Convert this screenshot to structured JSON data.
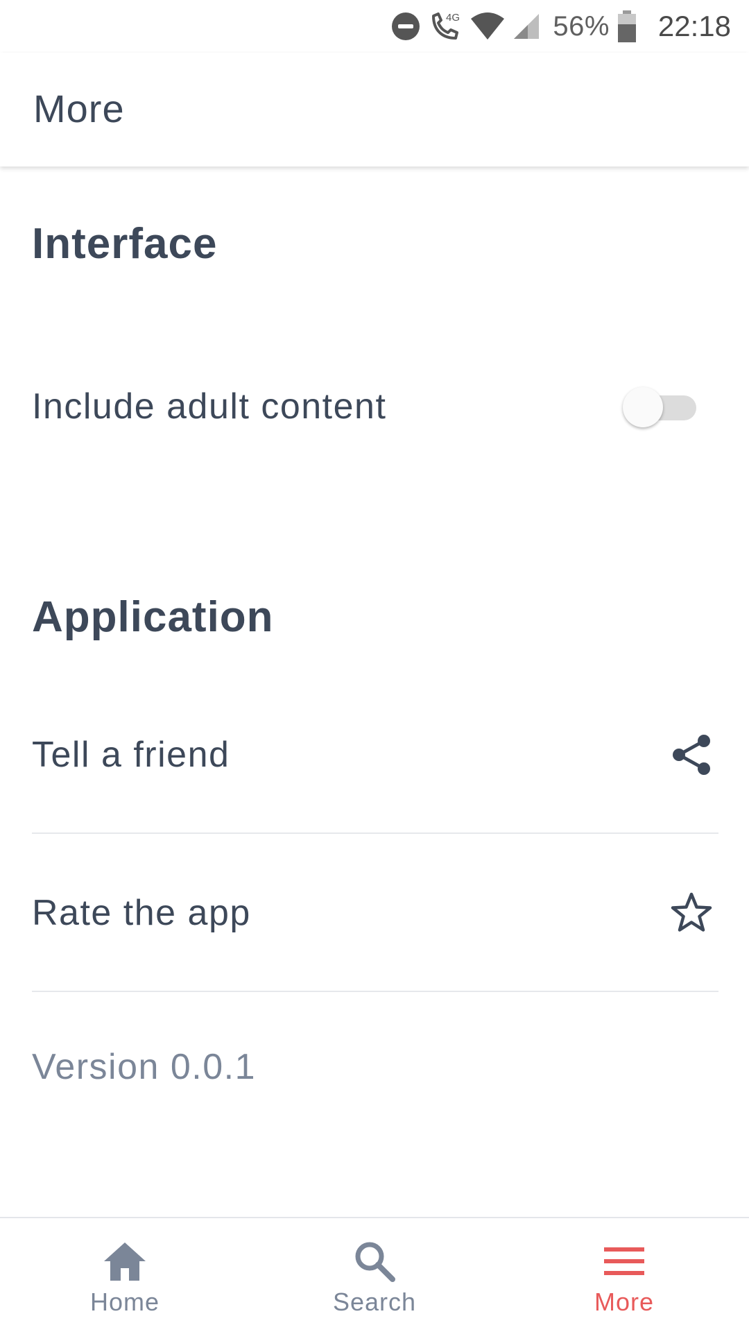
{
  "status_bar": {
    "network_type": "4G",
    "battery_percent": "56%",
    "clock": "22:18",
    "icons": [
      "do-not-disturb-icon",
      "wifi-call-icon",
      "wifi-icon",
      "cell-signal-icon",
      "battery-icon"
    ]
  },
  "toolbar": {
    "title": "More"
  },
  "sections": {
    "interface": {
      "header": "Interface",
      "adult_content_label": "Include adult content",
      "adult_content_enabled": false
    },
    "application": {
      "header": "Application",
      "tell_friend_label": "Tell a friend",
      "tell_friend_icon": "share-icon",
      "rate_app_label": "Rate the app",
      "rate_app_icon": "star-outline-icon",
      "version": "Version 0.0.1"
    }
  },
  "bottom_nav": {
    "items": [
      {
        "label": "Home",
        "icon": "home-icon",
        "active": false
      },
      {
        "label": "Search",
        "icon": "search-icon",
        "active": false
      },
      {
        "label": "More",
        "icon": "menu-icon",
        "active": true
      }
    ]
  },
  "colors": {
    "text_primary": "#3d4859",
    "text_secondary": "#7b8698",
    "nav_inactive": "#7b8698",
    "accent": "#e85a5a"
  }
}
